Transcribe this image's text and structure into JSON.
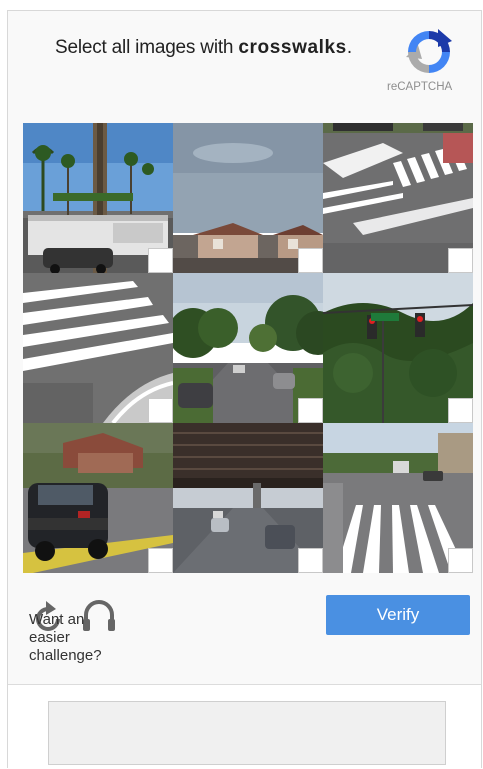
{
  "challenge": {
    "prompt_prefix": "Select all images with ",
    "prompt_target": "crosswalks",
    "prompt_suffix": ".",
    "brand_label": "reCAPTCHA",
    "brand_icon": "recaptcha-logo-icon"
  },
  "tiles": [
    {
      "scene": "palm-trees-building-car",
      "selected": false
    },
    {
      "scene": "residential-street-sky",
      "selected": false
    },
    {
      "scene": "crosswalk-intersection",
      "selected": false
    },
    {
      "scene": "crosswalk-closeup",
      "selected": false
    },
    {
      "scene": "tree-lined-street",
      "selected": false
    },
    {
      "scene": "traffic-lights-trees",
      "selected": false
    },
    {
      "scene": "suv-on-road",
      "selected": false
    },
    {
      "scene": "overpass-highway",
      "selected": false
    },
    {
      "scene": "crosswalk-parking-lot",
      "selected": false
    }
  ],
  "footer": {
    "reload_icon": "reload-icon",
    "audio_icon": "headphones-icon",
    "easier_lines": [
      "Want an",
      "easier",
      "challenge?"
    ],
    "verify_label": "Verify"
  },
  "colors": {
    "verify_button": "#4a90e2",
    "background": "#f9f9f9"
  }
}
